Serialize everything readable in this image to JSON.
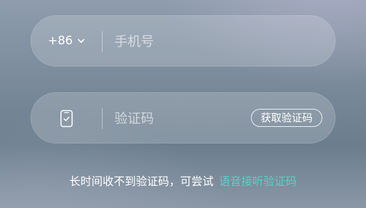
{
  "phone_field": {
    "country_code": "+86",
    "country_icon": "chevron-down-icon",
    "placeholder": "手机号",
    "value": ""
  },
  "code_field": {
    "icon": "phone-check-icon",
    "placeholder": "验证码",
    "value": "",
    "get_code_label": "获取验证码"
  },
  "hint": {
    "text": "长时间收不到验证码，可尝试",
    "voice_link": "语音接听验证码"
  },
  "colors": {
    "link": "#4fd6c6",
    "text": "#ffffff"
  }
}
